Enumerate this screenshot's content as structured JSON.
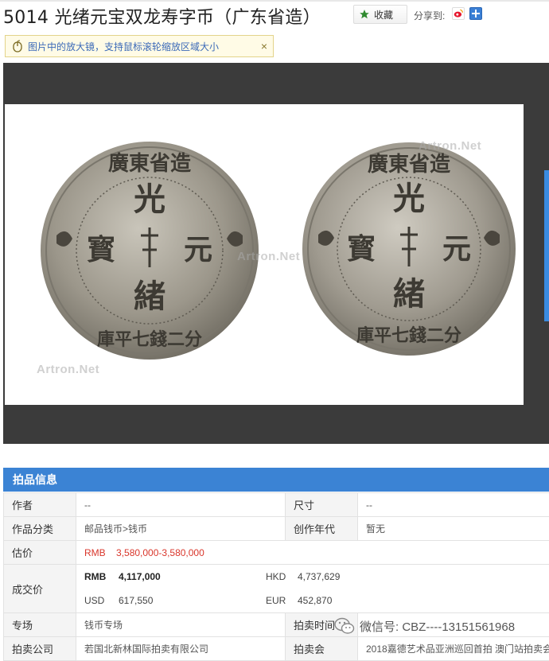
{
  "header": {
    "title": "5014 光绪元宝双龙寿字币（广东省造）",
    "favorite_label": "收藏",
    "share_label": "分享到:"
  },
  "tip": {
    "text": "图片中的放大镜，支持鼠标滚轮缩放区域大小",
    "close": "×"
  },
  "viewer": {
    "watermark": "Artron.Net",
    "coin_legend_top": "廣東省造",
    "coin_center_top": "光",
    "coin_center_left": "寳",
    "coin_center_right": "元",
    "coin_center_bottom": "緒",
    "coin_legend_bottom": "庫平七錢二分"
  },
  "info": {
    "heading": "拍品信息",
    "rows": {
      "author_label": "作者",
      "author_value": "--",
      "size_label": "尺寸",
      "size_value": "--",
      "category_label": "作品分类",
      "category_value": "邮品钱币>钱币",
      "year_label": "创作年代",
      "year_value": "暂无",
      "estimate_label": "估价",
      "estimate_currency": "RMB",
      "estimate_value": "3,580,000-3,580,000",
      "deal_label": "成交价",
      "rmb_label": "RMB",
      "rmb_value": "4,117,000",
      "hkd_label": "HKD",
      "hkd_value": "4,737,629",
      "usd_label": "USD",
      "usd_value": "617,550",
      "eur_label": "EUR",
      "eur_value": "452,870",
      "session_label": "专场",
      "session_value": "钱币专场",
      "time_label": "拍卖时间",
      "company_label": "拍卖公司",
      "company_value": "若国北新林国际拍卖有限公司",
      "auction_label": "拍卖会",
      "auction_value": "2018嘉德艺术品亚洲巡回首拍 澳门站拍卖会"
    }
  },
  "overlay": {
    "wechat_text": "微信号: CBZ----13151561968"
  }
}
